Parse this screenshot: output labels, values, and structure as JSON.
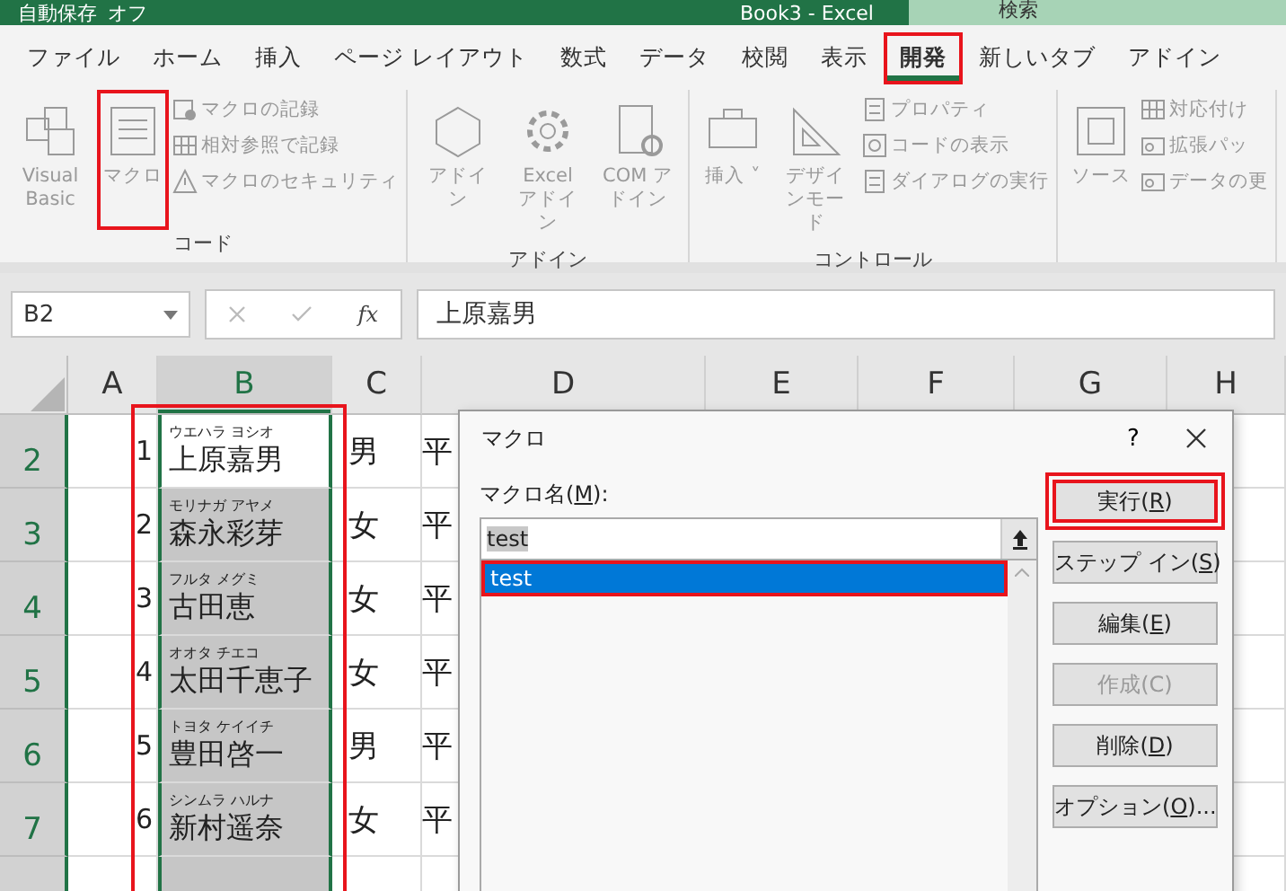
{
  "title_bar": {
    "autosave": "自動保存",
    "autosave_state": "オフ",
    "title": "Book3  -  Excel",
    "search": "検索"
  },
  "tabs": [
    {
      "label": "ファイル",
      "selected": false,
      "highlighted": false
    },
    {
      "label": "ホーム",
      "selected": false,
      "highlighted": false
    },
    {
      "label": "挿入",
      "selected": false,
      "highlighted": false
    },
    {
      "label": "ページ レイアウト",
      "selected": false,
      "highlighted": false
    },
    {
      "label": "数式",
      "selected": false,
      "highlighted": false
    },
    {
      "label": "データ",
      "selected": false,
      "highlighted": false
    },
    {
      "label": "校閲",
      "selected": false,
      "highlighted": false
    },
    {
      "label": "表示",
      "selected": false,
      "highlighted": false
    },
    {
      "label": "開発",
      "selected": true,
      "highlighted": true
    },
    {
      "label": "新しいタブ",
      "selected": false,
      "highlighted": false
    },
    {
      "label": "アドイン",
      "selected": false,
      "highlighted": false
    }
  ],
  "ribbon": {
    "groups": [
      {
        "label": "コード",
        "large": [
          {
            "label": "Visual Basic",
            "highlighted": false
          },
          {
            "label": "マクロ",
            "highlighted": true
          }
        ],
        "small": [
          {
            "label": "マクロの記録"
          },
          {
            "label": "相対参照で記録"
          },
          {
            "label": "マクロのセキュリティ"
          }
        ]
      },
      {
        "label": "アドイン",
        "large": [
          {
            "label": "アドイン",
            "highlighted": false
          },
          {
            "label": "Excel アドイン",
            "highlighted": false
          },
          {
            "label": "COM アドイン",
            "highlighted": false
          }
        ]
      },
      {
        "label": "コントロール",
        "large": [
          {
            "label": "挿入 ˅",
            "highlighted": false
          },
          {
            "label": "デザインモード",
            "highlighted": false
          }
        ],
        "small": [
          {
            "label": "プロパティ"
          },
          {
            "label": "コードの表示"
          },
          {
            "label": "ダイアログの実行"
          }
        ]
      },
      {
        "large": [
          {
            "label": "ソース",
            "highlighted": false
          }
        ],
        "small": [
          {
            "label": "対応付け"
          },
          {
            "label": "拡張パッ"
          },
          {
            "label": "データの更"
          }
        ]
      }
    ]
  },
  "formula_bar": {
    "name_box": "B2",
    "fx": "fx",
    "value": "上原嘉男"
  },
  "sheet": {
    "highlight_frame": true,
    "columns": [
      {
        "label": "A",
        "selected": false
      },
      {
        "label": "B",
        "selected": true
      },
      {
        "label": "C",
        "selected": false
      },
      {
        "label": "D",
        "selected": false
      },
      {
        "label": "E",
        "selected": false
      },
      {
        "label": "F",
        "selected": false
      },
      {
        "label": "G",
        "selected": false
      },
      {
        "label": "H",
        "selected": false
      }
    ],
    "rows": [
      {
        "header": "2",
        "number": "1",
        "furigana": "ウエハラ ヨシオ",
        "name": "上原嘉男",
        "gender": "男",
        "column_d": "平",
        "active": true
      },
      {
        "header": "3",
        "number": "2",
        "furigana": "モリナガ アヤメ",
        "name": "森永彩芽",
        "gender": "女",
        "column_d": "平",
        "active": false
      },
      {
        "header": "4",
        "number": "3",
        "furigana": "フルタ メグミ",
        "name": "古田恵",
        "gender": "女",
        "column_d": "平",
        "active": false
      },
      {
        "header": "5",
        "number": "4",
        "furigana": "オオタ チエコ",
        "name": "太田千恵子",
        "gender": "女",
        "column_d": "平",
        "active": false
      },
      {
        "header": "6",
        "number": "5",
        "furigana": "トヨタ ケイイチ",
        "name": "豊田啓一",
        "gender": "男",
        "column_d": "平",
        "active": false
      },
      {
        "header": "7",
        "number": "6",
        "furigana": "シンムラ ハルナ",
        "name": "新村遥奈",
        "gender": "女",
        "column_d": "平",
        "active": false
      }
    ]
  },
  "dialog": {
    "title": "マクロ",
    "help": "?",
    "label": {
      "prefix": "マクロ名(",
      "key": "M",
      "suffix": "):"
    },
    "value": "test",
    "items": [
      {
        "label": "test",
        "selected": true,
        "highlighted": true
      }
    ],
    "buttons": [
      {
        "prefix": "実行(",
        "key": "R",
        "suffix": ")",
        "default": true,
        "disabled": false,
        "highlighted": true
      },
      {
        "prefix": "ステップ イン(",
        "key": "S",
        "suffix": ")",
        "default": false,
        "disabled": false,
        "highlighted": false
      },
      {
        "prefix": "編集(",
        "key": "E",
        "suffix": ")",
        "default": false,
        "disabled": false,
        "highlighted": false
      },
      {
        "prefix": "作成(C)",
        "default": false,
        "disabled": true,
        "highlighted": false
      },
      {
        "prefix": "削除(",
        "key": "D",
        "suffix": ")",
        "default": false,
        "disabled": false,
        "highlighted": false
      },
      {
        "prefix": "オプション(",
        "key": "O",
        "suffix": ")...",
        "default": false,
        "disabled": false,
        "highlighted": false
      }
    ]
  }
}
